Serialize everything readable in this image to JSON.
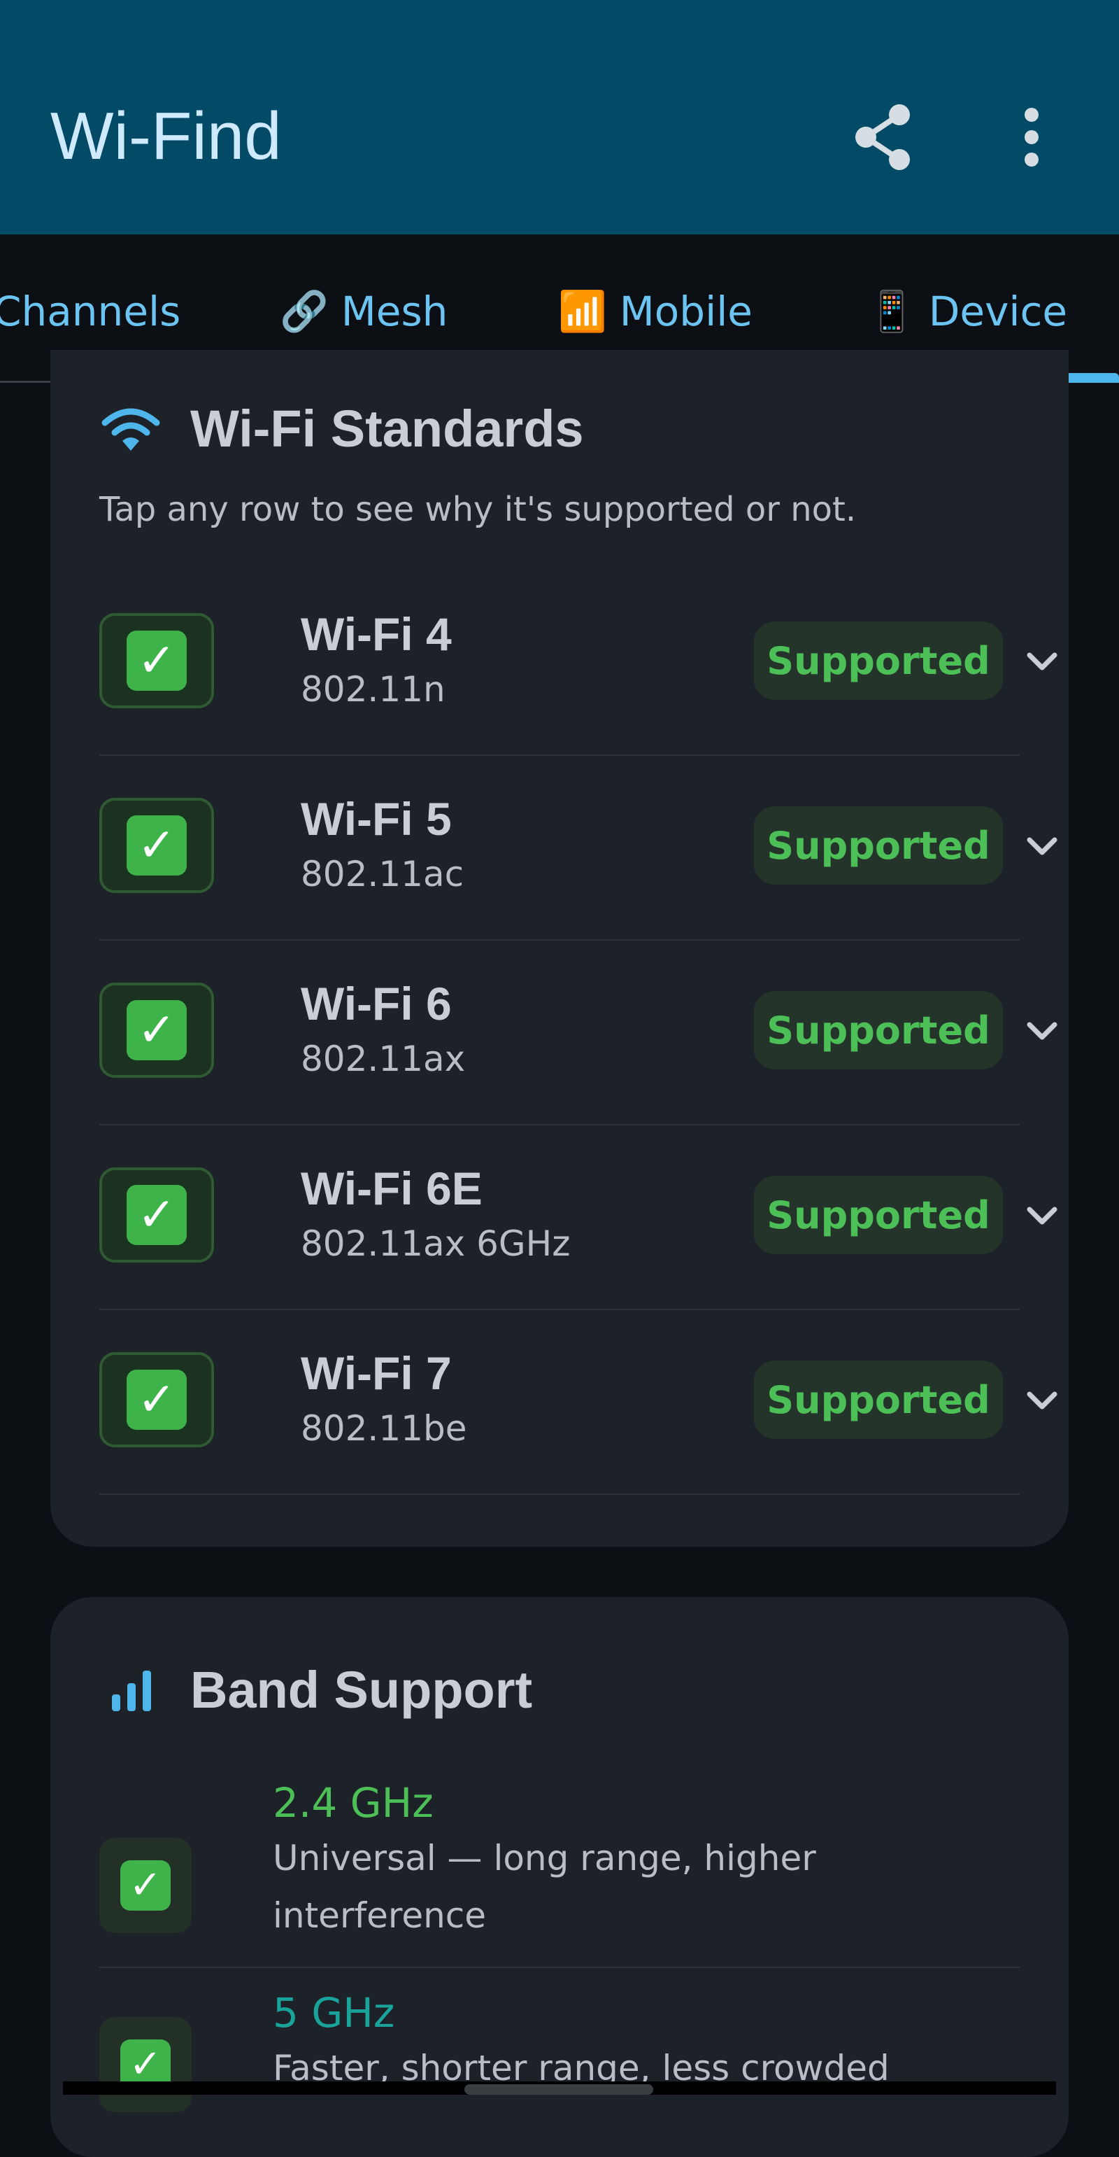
{
  "app": {
    "title": "Wi-Find",
    "header_icons": [
      "share-icon",
      "more-vert-icon"
    ],
    "colors": {
      "appbar": "#024a66",
      "accent": "#4fb6ec",
      "supported_green": "#4cbf57"
    }
  },
  "tabs": [
    {
      "label": "Channels",
      "emoji": ""
    },
    {
      "label": "Mesh",
      "emoji": "🔗"
    },
    {
      "label": "Mobile",
      "emoji": "📶"
    },
    {
      "label": "Device",
      "emoji": "📱",
      "selected": true
    }
  ],
  "standards": {
    "title": "Wi-Fi Standards",
    "icon": "wifi-icon",
    "subtitle": "Tap any row to see why it's supported or not.",
    "rows": [
      {
        "name": "Wi-Fi 4",
        "code": "802.11n",
        "status": "Supported",
        "check": "✓"
      },
      {
        "name": "Wi-Fi 5",
        "code": "802.11ac",
        "status": "Supported",
        "check": "✓"
      },
      {
        "name": "Wi-Fi 6",
        "code": "802.11ax",
        "status": "Supported",
        "check": "✓"
      },
      {
        "name": "Wi-Fi 6E",
        "code": "802.11ax 6GHz",
        "status": "Supported",
        "check": "✓"
      },
      {
        "name": "Wi-Fi 7",
        "code": "802.11be",
        "status": "Supported",
        "check": "✓"
      }
    ]
  },
  "bands": {
    "title": "Band Support",
    "icon": "signal-bars-icon",
    "rows": [
      {
        "name": "2.4 GHz",
        "description": "Universal — long range, higher interference",
        "color": "#4cbf57",
        "check": "✓"
      },
      {
        "name": "5 GHz",
        "description": "Faster, shorter range, less crowded",
        "color": "#1aa39a",
        "check": "✓"
      }
    ]
  }
}
